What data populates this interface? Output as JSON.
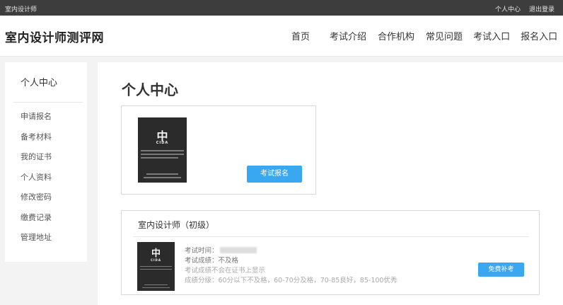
{
  "topbar": {
    "site_name": "室内设计师",
    "links": [
      "个人中心",
      "退出登录"
    ]
  },
  "header": {
    "logo": "室内设计师测评网",
    "nav": [
      "首页",
      "考试介绍",
      "合作机构",
      "常见问题",
      "考试入口",
      "报名入口"
    ]
  },
  "sidebar": {
    "title": "个人中心",
    "items": [
      "申请报名",
      "备考材料",
      "我的证书",
      "个人资料",
      "修改密码",
      "缴费记录",
      "管理地址"
    ]
  },
  "main": {
    "page_title": "个人中心",
    "apply_button": "考试报名",
    "cert_brand": "CIDA",
    "exam_card": {
      "title": "室内设计师（初级）",
      "exam_time_label": "考试时间：",
      "result_label": "考试成绩：",
      "result_value": "不及格",
      "note": "考试成绩不会在证书上显示",
      "grading": "成绩分级：60分以下不及格，60-70分及格，70-85良好，85-100优秀",
      "retake_button": "免费补考"
    }
  },
  "colors": {
    "accent": "#3aa8f0",
    "topbar_bg": "#3d3d3d",
    "page_bg": "#f3f3f3"
  }
}
